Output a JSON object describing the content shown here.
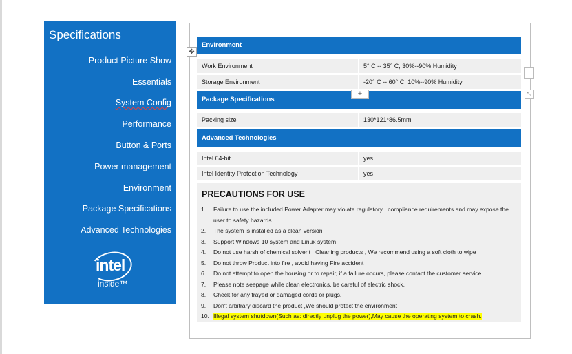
{
  "sidebar": {
    "title": "Specifications",
    "items": [
      {
        "label": "Product Picture Show"
      },
      {
        "label": "Essentials"
      },
      {
        "label": "System Config"
      },
      {
        "label": "Performance"
      },
      {
        "label": "Button & Ports"
      },
      {
        "label": "Power management"
      },
      {
        "label": "Environment"
      },
      {
        "label": "Package Specifications"
      },
      {
        "label": "Advanced Technologies"
      }
    ],
    "logo": {
      "word": "intel",
      "inside": "inside™"
    }
  },
  "document": {
    "environment": {
      "heading": "Environment",
      "rows": [
        {
          "label": "Work Environment",
          "value": "5° C  --  35° C,  30%--90% Humidity"
        },
        {
          "label": "Storage Environment",
          "value": "-20° C  --  60° C, 10%--90% Humidity"
        }
      ]
    },
    "package": {
      "heading": "Package Specifications",
      "rows": [
        {
          "label": "Packing size",
          "value": "130*121*86.5mm"
        }
      ]
    },
    "advanced": {
      "heading": "Advanced Technologies",
      "rows": [
        {
          "label": "Intel 64-bit",
          "value": "yes"
        },
        {
          "label": "Intel Identity Protection Technology",
          "value": "yes"
        }
      ]
    },
    "precautions": {
      "title": "PRECAUTIONS FOR USE",
      "items": [
        {
          "num": "1.",
          "text": "Failure to use the included Power Adapter may violate regulatory , compliance requirements and may expose the user to safety hazards."
        },
        {
          "num": "2.",
          "text": "The system is installed as a clean version"
        },
        {
          "num": "3.",
          "text": "Support Windows 10 system and Linux system"
        },
        {
          "num": "4.",
          "text": "Do not use harsh of chemical solvent , Cleaning products , We recommend using a soft cloth to wipe"
        },
        {
          "num": "5.",
          "text": "Do not throw Product into fire , avoid having Fire accident"
        },
        {
          "num": "6.",
          "text": "Do not attempt to open the housing or to repair, if a failure occurs, please contact the customer service"
        },
        {
          "num": "7.",
          "text": "Please note seepage while clean electronics, be careful of electric shock."
        },
        {
          "num": "8.",
          "text": "Check for any frayed or damaged cords or plugs."
        },
        {
          "num": "9.",
          "text": "Don't arbitrary discard the product ,We should protect the environment"
        },
        {
          "num": "10.",
          "text": "Illegal system shutdown(Such as: directly unplug the power),May cause the operating system to crash."
        }
      ]
    }
  },
  "editor": {
    "move_handle": "✥",
    "insert_row": "+",
    "insert_col": "+",
    "resize_handle": "⤡"
  },
  "colors": {
    "accent": "#1271c4",
    "row_bg": "#efefef",
    "highlight": "#ffff00"
  }
}
